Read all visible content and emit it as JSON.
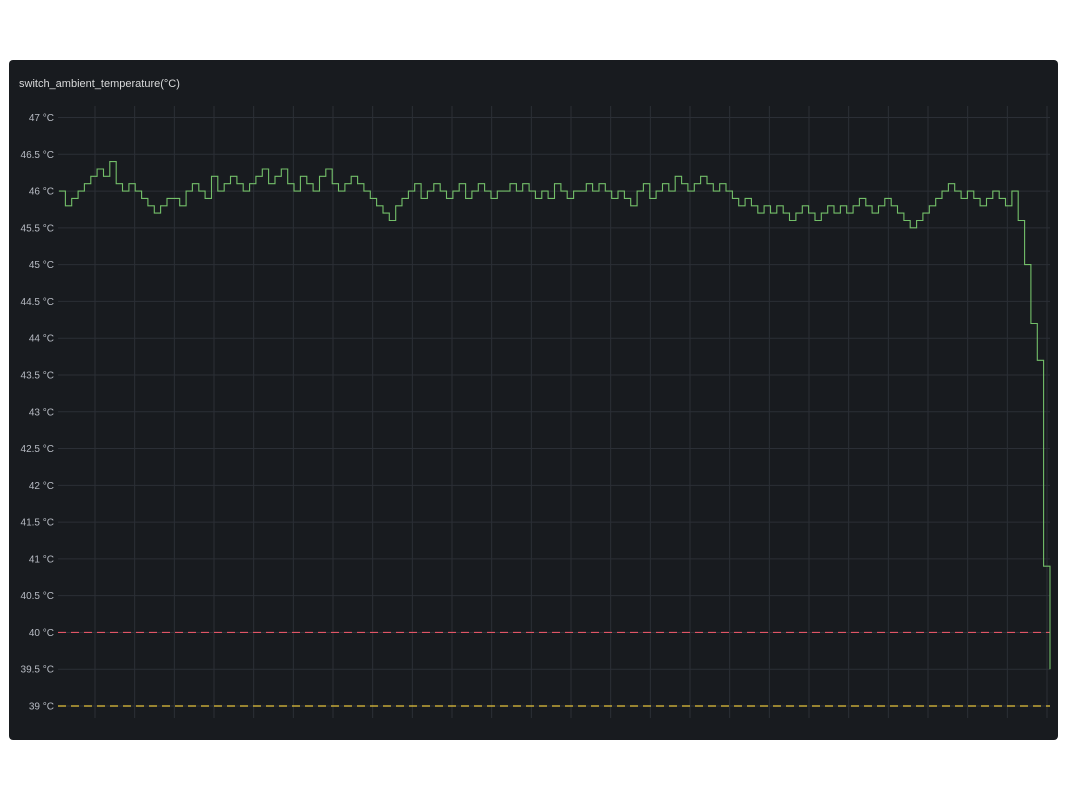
{
  "panel": {
    "title": "switch_ambient_temperature(°C)"
  },
  "colors": {
    "series": "#73bf69",
    "threshold_red": "#e05566",
    "threshold_yellow": "#e5c43c",
    "grid": "#2b2f36",
    "background": "#181b1f"
  },
  "chart_data": {
    "type": "line",
    "title": "switch_ambient_temperature(°C)",
    "xlabel": "",
    "ylabel": "",
    "ylim": [
      38.85,
      47.15
    ],
    "yticks": [
      39,
      39.5,
      40,
      40.5,
      41,
      41.5,
      42,
      42.5,
      43,
      43.5,
      44,
      44.5,
      45,
      45.5,
      46,
      46.5,
      47
    ],
    "ytick_labels": [
      "39 °C",
      "39.5 °C",
      "40 °C",
      "40.5 °C",
      "41 °C",
      "41.5 °C",
      "42 °C",
      "42.5 °C",
      "43 °C",
      "43.5 °C",
      "44 °C",
      "44.5 °C",
      "45 °C",
      "45.5 °C",
      "46 °C",
      "46.5 °C",
      "47 °C"
    ],
    "x_tick_labels": [],
    "grid": true,
    "thresholds": [
      {
        "value": 40,
        "color": "#e05566",
        "style": "dashed"
      },
      {
        "value": 39,
        "color": "#e5c43c",
        "style": "dashed"
      }
    ],
    "series": [
      {
        "values": [
          46.0,
          45.8,
          45.9,
          46.0,
          46.1,
          46.2,
          46.3,
          46.2,
          46.4,
          46.1,
          46.0,
          46.1,
          46.0,
          45.9,
          45.8,
          45.7,
          45.8,
          45.9,
          45.9,
          45.8,
          46.0,
          46.1,
          46.0,
          45.9,
          46.2,
          46.0,
          46.1,
          46.2,
          46.1,
          46.0,
          46.1,
          46.2,
          46.3,
          46.1,
          46.2,
          46.3,
          46.1,
          46.0,
          46.2,
          46.1,
          46.0,
          46.2,
          46.3,
          46.1,
          46.0,
          46.1,
          46.2,
          46.1,
          46.0,
          45.9,
          45.8,
          45.7,
          45.6,
          45.8,
          45.9,
          46.0,
          46.1,
          45.9,
          46.0,
          46.1,
          46.0,
          45.9,
          46.0,
          46.1,
          45.9,
          46.0,
          46.1,
          46.0,
          45.9,
          46.0,
          46.0,
          46.1,
          46.0,
          46.1,
          46.0,
          45.9,
          46.0,
          45.9,
          46.1,
          46.0,
          45.9,
          46.0,
          46.0,
          46.1,
          46.0,
          46.1,
          46.0,
          45.9,
          46.0,
          45.9,
          45.8,
          46.0,
          46.1,
          45.9,
          46.0,
          46.1,
          46.0,
          46.2,
          46.1,
          46.0,
          46.1,
          46.2,
          46.1,
          46.0,
          46.1,
          46.0,
          45.9,
          45.8,
          45.9,
          45.8,
          45.7,
          45.8,
          45.7,
          45.8,
          45.7,
          45.6,
          45.7,
          45.8,
          45.7,
          45.6,
          45.7,
          45.8,
          45.7,
          45.8,
          45.7,
          45.8,
          45.9,
          45.8,
          45.7,
          45.8,
          45.9,
          45.8,
          45.7,
          45.6,
          45.5,
          45.6,
          45.7,
          45.8,
          45.9,
          46.0,
          46.1,
          46.0,
          45.9,
          46.0,
          45.9,
          45.8,
          45.9,
          46.0,
          45.9,
          45.8,
          46.0,
          45.6,
          45.0,
          44.2,
          43.7,
          40.9,
          39.5
        ]
      }
    ]
  }
}
